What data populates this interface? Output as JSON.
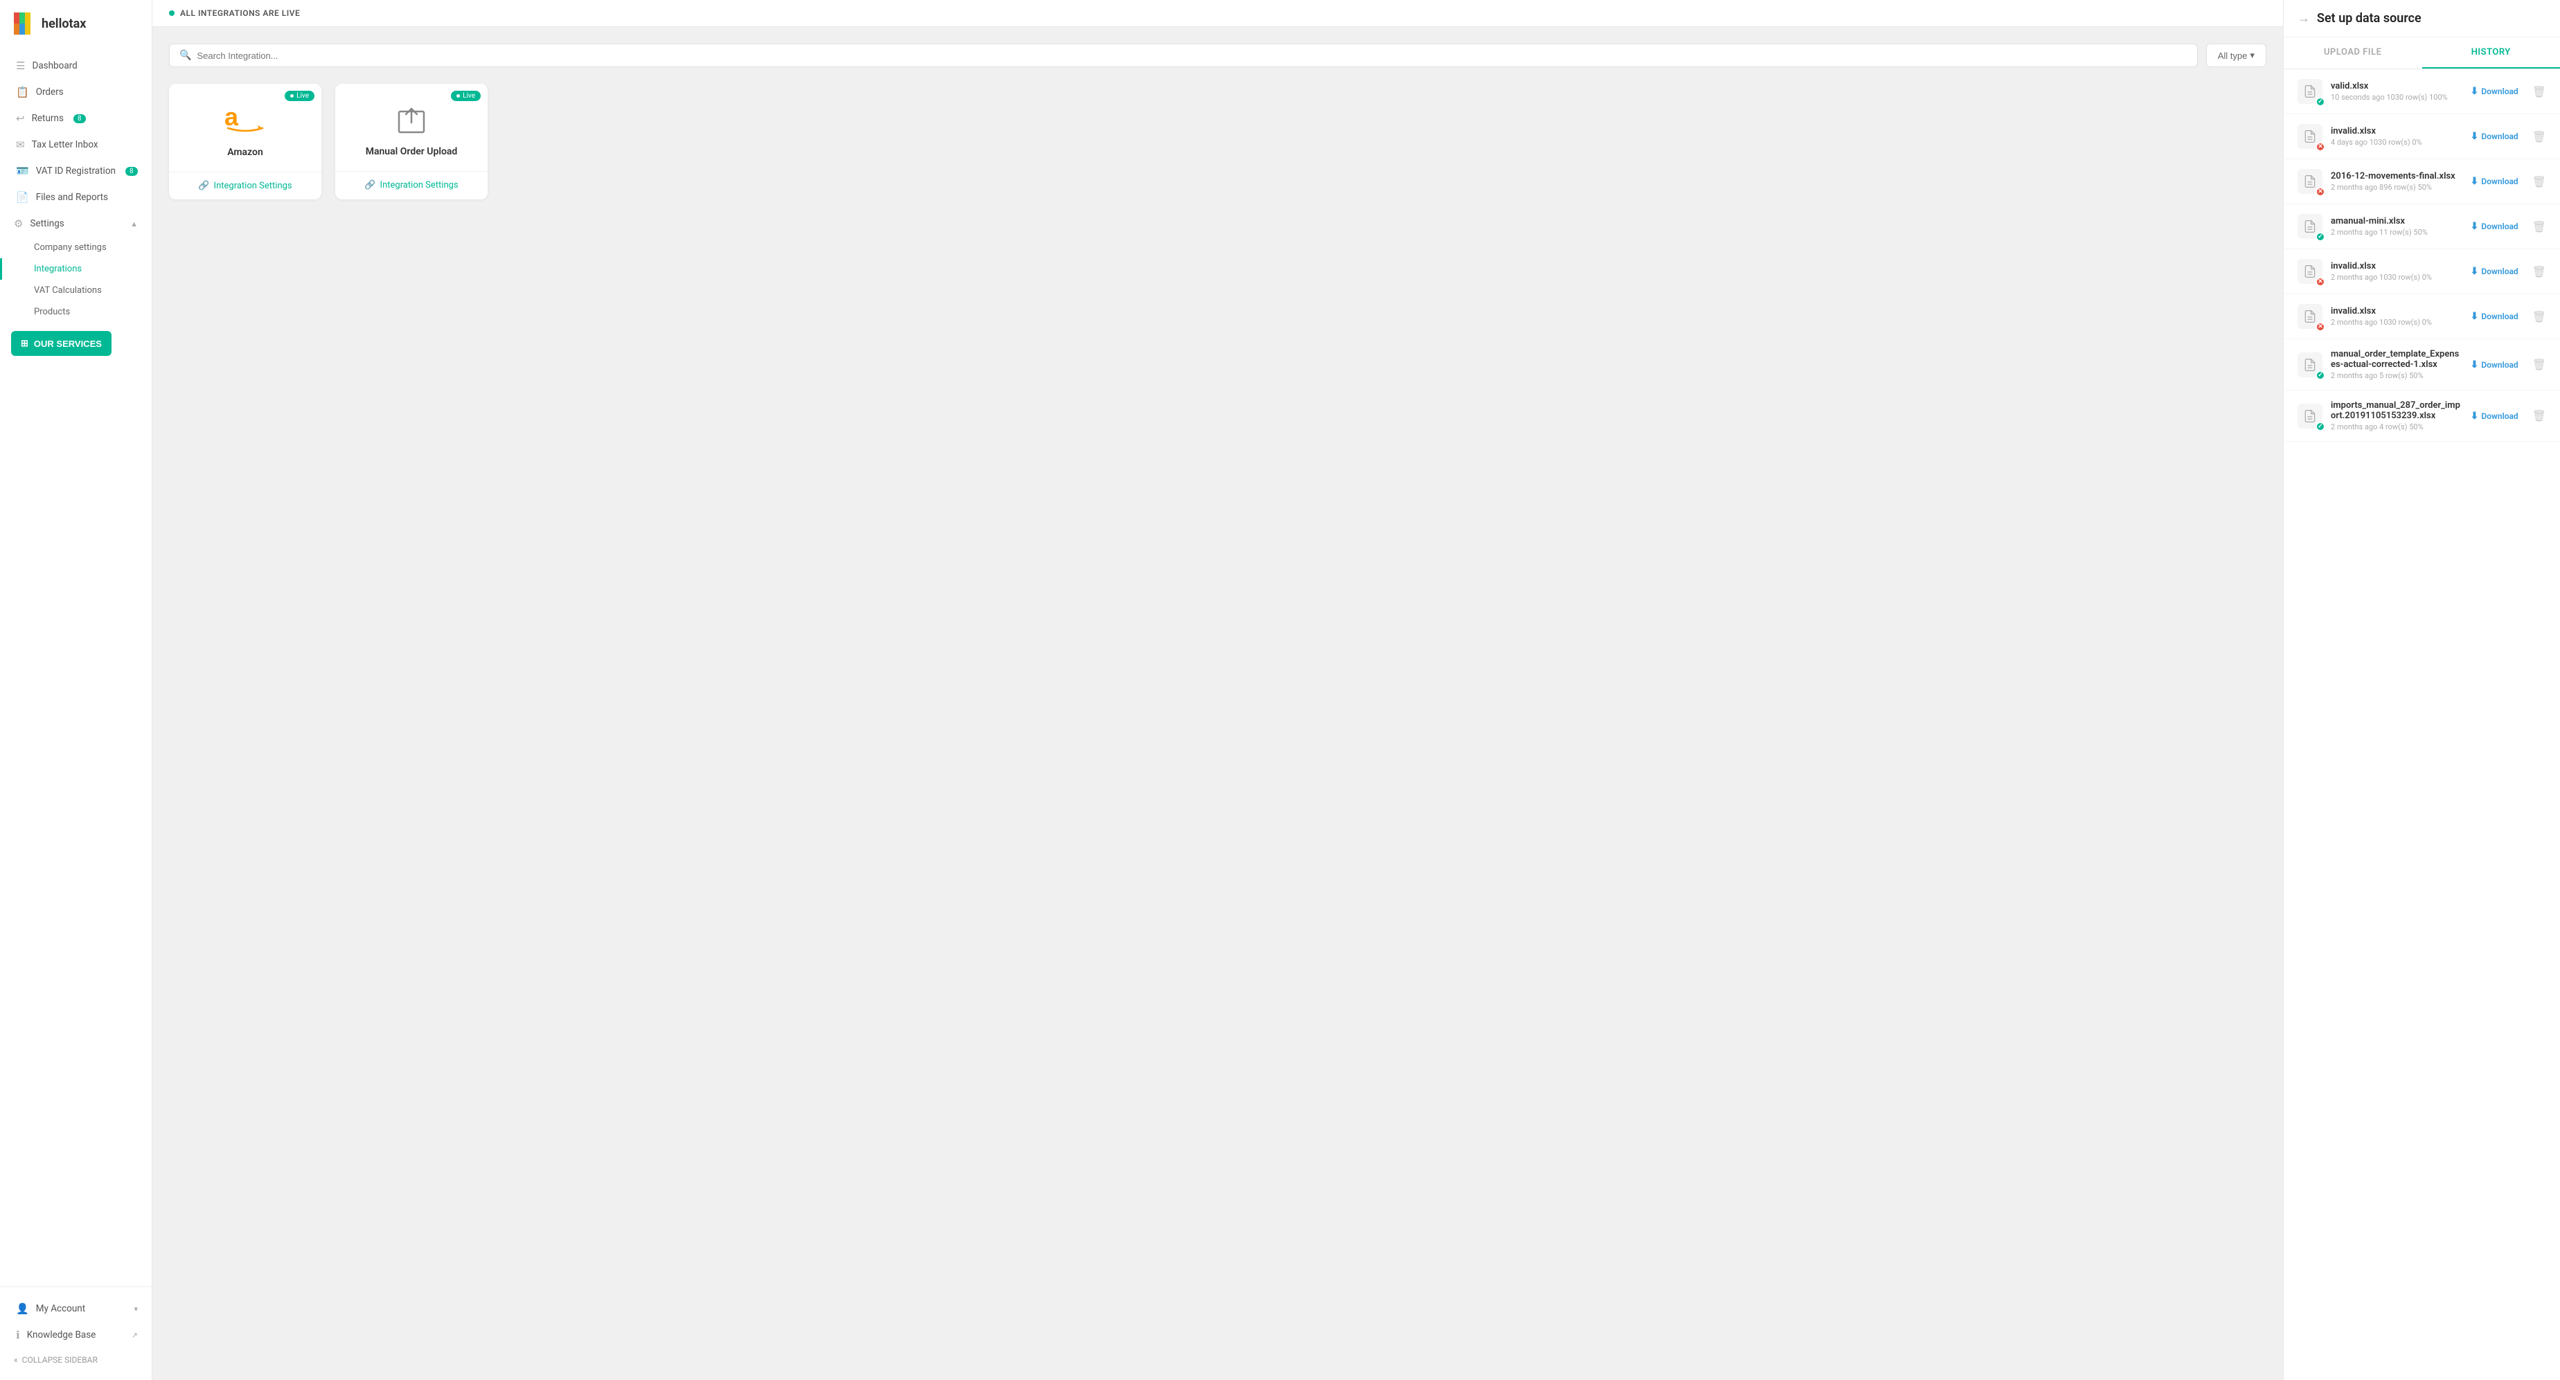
{
  "sidebar": {
    "logo_text": "hellotax",
    "nav_items": [
      {
        "id": "dashboard",
        "label": "Dashboard",
        "icon": "☰"
      },
      {
        "id": "orders",
        "label": "Orders",
        "icon": "📋"
      },
      {
        "id": "returns",
        "label": "Returns",
        "icon": "₿",
        "badge": "8"
      },
      {
        "id": "tax-letter-inbox",
        "label": "Tax Letter Inbox",
        "icon": "✉"
      },
      {
        "id": "vat-id",
        "label": "VAT ID Registration",
        "icon": "🪪",
        "badge": "8"
      },
      {
        "id": "files-reports",
        "label": "Files and Reports",
        "icon": "📄"
      }
    ],
    "settings_label": "Settings",
    "settings_items": [
      {
        "id": "company-settings",
        "label": "Company settings"
      },
      {
        "id": "integrations",
        "label": "Integrations",
        "active": true
      },
      {
        "id": "vat-calculations",
        "label": "VAT Calculations"
      },
      {
        "id": "products",
        "label": "Products"
      }
    ],
    "our_services_label": "OUR SERVICES",
    "my_account_label": "My Account",
    "knowledge_base_label": "Knowledge Base",
    "collapse_label": "COLLAPSE SIDEBAR"
  },
  "main": {
    "status_text": "ALL INTEGRATIONS ARE LIVE",
    "search_placeholder": "Search Integration...",
    "filter_label": "All type",
    "cards": [
      {
        "id": "amazon",
        "name": "Amazon",
        "live": true,
        "live_label": "Live",
        "action_label": "Integration Settings"
      },
      {
        "id": "manual-order-upload",
        "name": "Manual Order Upload",
        "live": true,
        "live_label": "Live",
        "action_label": "Integration Settings"
      }
    ]
  },
  "panel": {
    "title": "Set up data source",
    "tabs": [
      {
        "id": "upload-file",
        "label": "UPLOAD FILE"
      },
      {
        "id": "history",
        "label": "HISTORY",
        "active": true
      }
    ],
    "history_items": [
      {
        "id": 1,
        "name": "valid.xlsx",
        "meta": "10 seconds ago  1030 row(s)  100%",
        "status": "success",
        "download_label": "Download"
      },
      {
        "id": 2,
        "name": "invalid.xlsx",
        "meta": "4 days ago  1030 row(s)  0%",
        "status": "error",
        "download_label": "Download"
      },
      {
        "id": 3,
        "name": "2016-12-movements-final.xlsx",
        "meta": "2 months ago  896 row(s)  50%",
        "status": "error",
        "download_label": "Download"
      },
      {
        "id": 4,
        "name": "amanual-mini.xlsx",
        "meta": "2 months ago  11 row(s)  50%",
        "status": "success",
        "download_label": "Download"
      },
      {
        "id": 5,
        "name": "invalid.xlsx",
        "meta": "2 months ago  1030 row(s)  0%",
        "status": "error",
        "download_label": "Download"
      },
      {
        "id": 6,
        "name": "invalid.xlsx",
        "meta": "2 months ago  1030 row(s)  0%",
        "status": "error",
        "download_label": "Download"
      },
      {
        "id": 7,
        "name": "manual_order_template_Expenses-actual-corrected-1.xlsx",
        "meta": "2 months ago  5 row(s)  50%",
        "status": "success",
        "download_label": "Download"
      },
      {
        "id": 8,
        "name": "imports_manual_287_order_import.20191105153239.xlsx",
        "meta": "2 months ago  4 row(s)  50%",
        "status": "success",
        "download_label": "Download"
      }
    ]
  }
}
